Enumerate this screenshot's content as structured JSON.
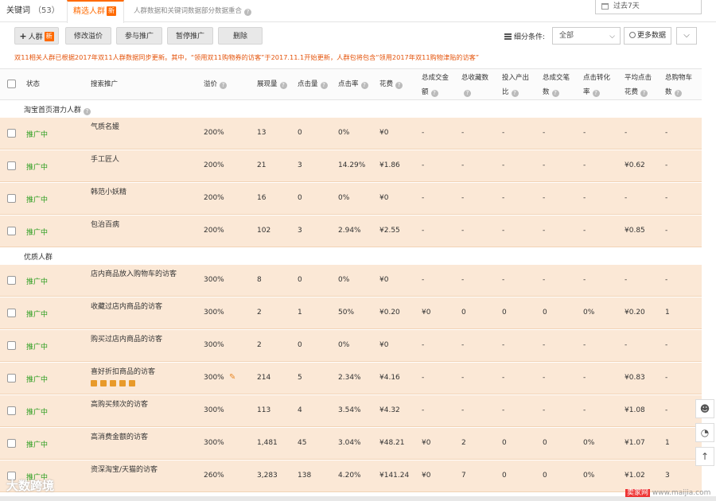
{
  "tabs": {
    "keywords_label": "关键词",
    "keywords_count": "（53）",
    "crowd_label": "精选人群",
    "crowd_badge": "新",
    "note": "人群数据和关键词数据部分数据重合"
  },
  "date_range": "过去7天",
  "toolbar": {
    "add_crowd": "人群",
    "add_crowd_badge": "新",
    "modify_premium": "修改溢价",
    "join_promo": "参与推广",
    "pause_promo": "暂停推广",
    "delete": "删除",
    "filter_label": "细分条件:",
    "filter_value": "全部",
    "more_data": "更多数据"
  },
  "notice": "双11相关人群已根据2017年双11人群数据同步更新。其中，“领用双11购物券的访客”于2017.11.1开始更新，人群包将包含“领用2017年双11购物津贴的访客”",
  "columns": {
    "status": "状态",
    "crowd": "搜索推广",
    "premium": "溢价",
    "impressions": "展现量",
    "clicks": "点击量",
    "ctr": "点击率",
    "cost": "花费",
    "total_gmv_a": "总成交金",
    "total_gmv_b": "额",
    "total_fav_a": "总收藏数",
    "roi_a": "投入产出",
    "roi_b": "比",
    "total_orders_a": "总成交笔",
    "total_orders_b": "数",
    "cvr_a": "点击转化",
    "cvr_b": "率",
    "avg_cpc_a": "平均点击",
    "avg_cpc_b": "花费",
    "total_cart_a": "总购物车",
    "total_cart_b": "数"
  },
  "sections": [
    {
      "title": "淘宝首页潜力人群",
      "rows": [
        {
          "status": "推广中",
          "name": "气质名媛",
          "premium": "200%",
          "impressions": "13",
          "clicks": "0",
          "ctr": "0%",
          "cost": "¥0",
          "gmv": "-",
          "fav": "-",
          "roi": "-",
          "orders": "-",
          "cvr": "-",
          "cpc": "-",
          "cart": "-"
        },
        {
          "status": "推广中",
          "name": "手工匠人",
          "premium": "200%",
          "impressions": "21",
          "clicks": "3",
          "ctr": "14.29%",
          "cost": "¥1.86",
          "gmv": "-",
          "fav": "-",
          "roi": "-",
          "orders": "-",
          "cvr": "-",
          "cpc": "¥0.62",
          "cart": "-"
        },
        {
          "status": "推广中",
          "name": "韩范小妖精",
          "premium": "200%",
          "impressions": "16",
          "clicks": "0",
          "ctr": "0%",
          "cost": "¥0",
          "gmv": "-",
          "fav": "-",
          "roi": "-",
          "orders": "-",
          "cvr": "-",
          "cpc": "-",
          "cart": "-"
        },
        {
          "status": "推广中",
          "name": "包治百病",
          "premium": "200%",
          "impressions": "102",
          "clicks": "3",
          "ctr": "2.94%",
          "cost": "¥2.55",
          "gmv": "-",
          "fav": "-",
          "roi": "-",
          "orders": "-",
          "cvr": "-",
          "cpc": "¥0.85",
          "cart": "-"
        }
      ]
    },
    {
      "title": "优质人群",
      "rows": [
        {
          "status": "推广中",
          "name": "店内商品放入购物车的访客",
          "premium": "300%",
          "impressions": "8",
          "clicks": "0",
          "ctr": "0%",
          "cost": "¥0",
          "gmv": "-",
          "fav": "-",
          "roi": "-",
          "orders": "-",
          "cvr": "-",
          "cpc": "-",
          "cart": "-"
        },
        {
          "status": "推广中",
          "name": "收藏过店内商品的访客",
          "premium": "300%",
          "impressions": "2",
          "clicks": "1",
          "ctr": "50%",
          "cost": "¥0.20",
          "gmv": "¥0",
          "fav": "0",
          "roi": "0",
          "orders": "0",
          "cvr": "0%",
          "cpc": "¥0.20",
          "cart": "1"
        },
        {
          "status": "推广中",
          "name": "购买过店内商品的访客",
          "premium": "300%",
          "impressions": "2",
          "clicks": "0",
          "ctr": "0%",
          "cost": "¥0",
          "gmv": "-",
          "fav": "-",
          "roi": "-",
          "orders": "-",
          "cvr": "-",
          "cpc": "-",
          "cart": "-"
        },
        {
          "status": "推广中",
          "name": "喜好折扣商品的访客",
          "premium": "300%",
          "impressions": "214",
          "clicks": "5",
          "ctr": "2.34%",
          "cost": "¥4.16",
          "gmv": "-",
          "fav": "-",
          "roi": "-",
          "orders": "-",
          "cvr": "-",
          "cpc": "¥0.83",
          "cart": "-"
        },
        {
          "status": "推广中",
          "name": "高购买频次的访客",
          "premium": "300%",
          "impressions": "113",
          "clicks": "4",
          "ctr": "3.54%",
          "cost": "¥4.32",
          "gmv": "-",
          "fav": "-",
          "roi": "-",
          "orders": "-",
          "cvr": "-",
          "cpc": "¥1.08",
          "cart": "-"
        },
        {
          "status": "推广中",
          "name": "高消费金额的访客",
          "premium": "300%",
          "impressions": "1,481",
          "clicks": "45",
          "ctr": "3.04%",
          "cost": "¥48.21",
          "gmv": "¥0",
          "fav": "2",
          "roi": "0",
          "orders": "0",
          "cvr": "0%",
          "cpc": "¥1.07",
          "cart": "1"
        },
        {
          "status": "推广中",
          "name": "资深淘宝/天猫的访客",
          "premium": "260%",
          "impressions": "3,283",
          "clicks": "138",
          "ctr": "4.20%",
          "cost": "¥141.24",
          "gmv": "¥0",
          "fav": "7",
          "roi": "0",
          "orders": "0",
          "cvr": "0%",
          "cpc": "¥1.02",
          "cart": "3"
        }
      ]
    }
  ],
  "watermark_left": "大数跨境",
  "watermark_right_badge": "卖家网",
  "watermark_right": "www.maijia.com"
}
